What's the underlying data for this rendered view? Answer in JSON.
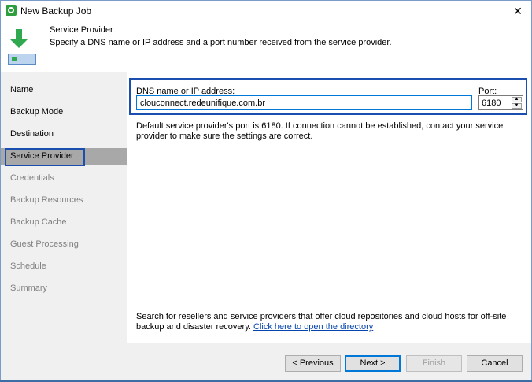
{
  "window": {
    "title": "New Backup Job",
    "close_glyph": "✕"
  },
  "header": {
    "title": "Service Provider",
    "subtitle": "Specify a DNS name or IP address and a port number received from the service provider."
  },
  "nav": {
    "items": [
      {
        "label": "Name",
        "state": "done"
      },
      {
        "label": "Backup Mode",
        "state": "done"
      },
      {
        "label": "Destination",
        "state": "done"
      },
      {
        "label": "Service Provider",
        "state": "active"
      },
      {
        "label": "Credentials",
        "state": "pending"
      },
      {
        "label": "Backup Resources",
        "state": "pending"
      },
      {
        "label": "Backup Cache",
        "state": "pending"
      },
      {
        "label": "Guest Processing",
        "state": "pending"
      },
      {
        "label": "Schedule",
        "state": "pending"
      },
      {
        "label": "Summary",
        "state": "pending"
      }
    ]
  },
  "form": {
    "dns_label": "DNS name or IP address:",
    "dns_value": "clouconnect.redeunifique.com.br",
    "port_label": "Port:",
    "port_value": "6180",
    "hint": "Default service provider's port is 6180. If connection cannot be established, contact your service provider to make sure the settings are correct."
  },
  "directory": {
    "text": "Search for resellers and service providers that offer cloud repositories and cloud hosts for off-site backup and disaster recovery.",
    "link_text": "Click here to open the directory"
  },
  "buttons": {
    "previous": "< Previous",
    "next": "Next >",
    "finish": "Finish",
    "cancel": "Cancel"
  },
  "colors": {
    "highlight_frame": "#1a4fb0",
    "active_nav_bg": "#a8a8a8",
    "link": "#0645ad"
  }
}
